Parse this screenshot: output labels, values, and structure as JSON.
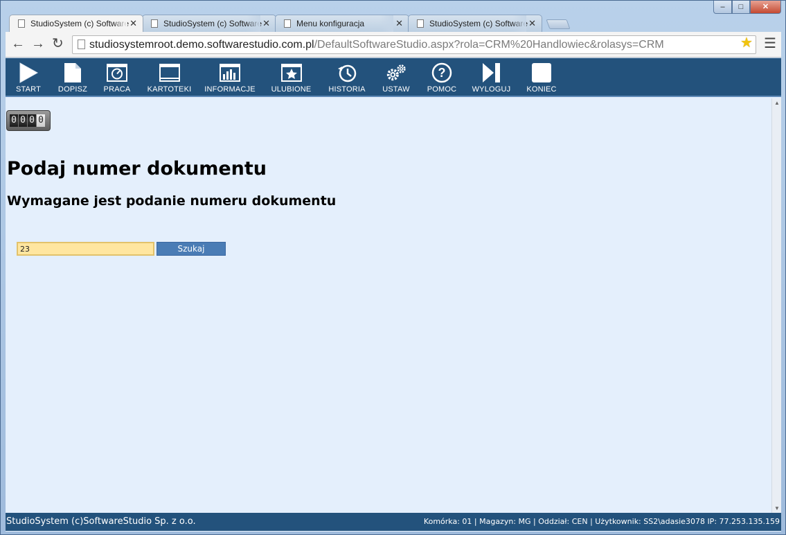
{
  "browser": {
    "tabs": [
      {
        "title": "StudioSystem (c) Software",
        "active": true
      },
      {
        "title": "StudioSystem (c) Software",
        "active": false
      },
      {
        "title": "Menu konfiguracja",
        "active": false
      },
      {
        "title": "StudioSystem (c) Software",
        "active": false
      }
    ],
    "url_host": "studiosystemroot.demo.softwarestudio.com.pl",
    "url_path": "/DefaultSoftwareStudio.aspx?rola=CRM%20Handlowiec&rolasys=CRM",
    "window_controls": {
      "minimize": "–",
      "maximize": "□",
      "close": "✕"
    }
  },
  "app_nav": {
    "items": [
      {
        "label": "START",
        "icon": "play-icon"
      },
      {
        "label": "DOPISZ",
        "icon": "new-document-icon"
      },
      {
        "label": "PRACA",
        "icon": "dashboard-window-icon"
      },
      {
        "label": "KARTOTEKI",
        "icon": "window-icon"
      },
      {
        "label": "INFORMACJE",
        "icon": "bar-chart-icon"
      },
      {
        "label": "ULUBIONE",
        "icon": "star-window-icon"
      },
      {
        "label": "HISTORIA",
        "icon": "history-icon"
      },
      {
        "label": "USTAW",
        "icon": "gears-icon"
      },
      {
        "label": "POMOC",
        "icon": "help-icon"
      },
      {
        "label": "WYLOGUJ",
        "icon": "logout-icon"
      },
      {
        "label": "KONIEC",
        "icon": "stop-icon"
      }
    ]
  },
  "counter": {
    "digits": [
      "0",
      "0",
      "0",
      "0"
    ]
  },
  "main": {
    "title": "Podaj numer dokumentu",
    "subtitle": "Wymagane jest podanie numeru dokumentu",
    "document_number_value": "23",
    "search_button_label": "Szukaj"
  },
  "status_bar": {
    "left": "StudioSystem (c)SoftwareStudio Sp. z o.o.",
    "right": "Komórka: 01 | Magazyn: MG | Oddział: CEN | Użytkownik: SS2\\adasie3078 IP: 77.253.135.159"
  },
  "colors": {
    "nav_bg": "#23527c",
    "content_bg": "#e4effc",
    "input_bg": "#ffe6a0",
    "button_bg": "#4a7cb5"
  }
}
